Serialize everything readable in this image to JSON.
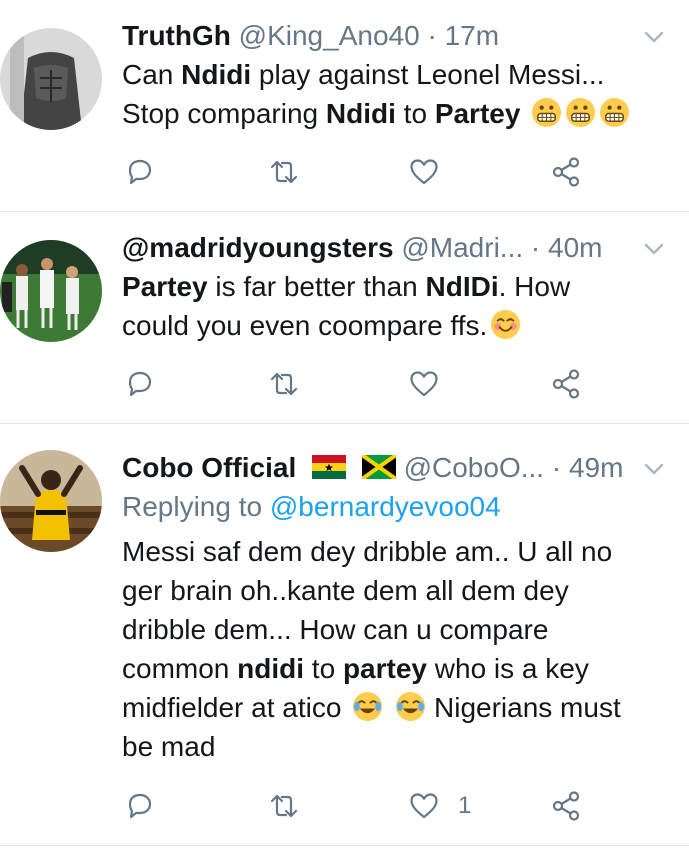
{
  "tweets": [
    {
      "name": "TruthGh",
      "handle": "@King_Ano40",
      "sep": "·",
      "time": "17m",
      "lines": [
        [
          {
            "t": "Can "
          },
          {
            "t": "Ndidi",
            "b": true
          },
          {
            "t": " play against Leonel Messi..."
          }
        ],
        [
          {
            "t": "Stop comparing "
          },
          {
            "t": "Ndidi",
            "b": true
          },
          {
            "t": " to "
          },
          {
            "t": "Partey",
            "b": true
          },
          {
            "t": " "
          }
        ]
      ],
      "emoji": [
        "grimacing-face-emoji",
        "grimacing-face-emoji",
        "grimacing-face-emoji"
      ],
      "like_count": ""
    },
    {
      "name": "@madridyoungsters",
      "handle": "@Madri...",
      "sep": "·",
      "time": "40m",
      "lines": [
        [
          {
            "t": "Partey",
            "b": true
          },
          {
            "t": " is far better than "
          },
          {
            "t": "NdIDi",
            "b": true
          },
          {
            "t": ". How"
          }
        ],
        [
          {
            "t": "could you even coompare ffs."
          }
        ]
      ],
      "emoji": [
        "smiling-face-emoji"
      ],
      "like_count": ""
    },
    {
      "name": "Cobo Official",
      "handle": "@CoboO...",
      "sep": "·",
      "time": "49m",
      "flags": [
        "ghana-flag",
        "jamaica-flag"
      ],
      "replying_prefix": "Replying to ",
      "replying_to": "@bernardyevoo04",
      "lines": [
        [
          {
            "t": "Messi saf dem dey dribble am.. U all no"
          }
        ],
        [
          {
            "t": "ger brain oh..kante dem all dem dey"
          }
        ],
        [
          {
            "t": "dribble dem... How can u compare"
          }
        ],
        [
          {
            "t": "common "
          },
          {
            "t": "ndidi",
            "b": true
          },
          {
            "t": " to "
          },
          {
            "t": "partey",
            "b": true
          },
          {
            "t": " who is a key"
          }
        ],
        [
          {
            "t": "midfielder at atico "
          },
          {
            "t": "  Nigerians must"
          }
        ],
        [
          {
            "t": "be mad"
          }
        ]
      ],
      "emoji": [
        "tears-of-joy-emoji",
        "tears-of-joy-emoji"
      ],
      "like_count": "1"
    }
  ],
  "icons": [
    "reply-icon",
    "retweet-icon",
    "like-icon",
    "share-icon",
    "chevron-down-icon"
  ],
  "colors": {
    "text": "#14171a",
    "muted": "#657786",
    "link": "#1da1f2",
    "divider": "#e1e8ed",
    "emoji": "#ffcc4d"
  }
}
